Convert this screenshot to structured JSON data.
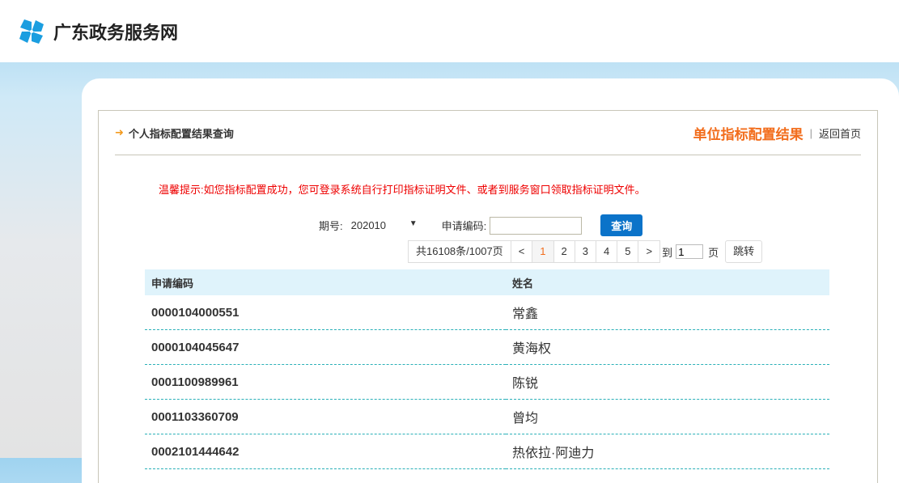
{
  "site": {
    "title": "广东政务服务网"
  },
  "panel": {
    "title": "个人指标配置结果查询",
    "link_unit": "单位指标配置结果",
    "separator": "|",
    "link_home": "返回首页",
    "tip": "温馨提示:如您指标配置成功，您可登录系统自行打印指标证明文件、或者到服务窗口领取指标证明文件。"
  },
  "query": {
    "period_label": "期号:",
    "period_value": "202010",
    "code_label": "申请编码:",
    "code_value": "",
    "search_button": "查询"
  },
  "pager": {
    "summary": "共16108条/1007页",
    "prev": "<",
    "pages": [
      "1",
      "2",
      "3",
      "4",
      "5"
    ],
    "current": "1",
    "next": ">",
    "goto_label": "到",
    "goto_value": "1",
    "page_unit": "页",
    "jump_button": "跳转"
  },
  "table": {
    "headers": [
      "申请编码",
      "姓名"
    ],
    "rows": [
      [
        "0000104000551",
        "常鑫"
      ],
      [
        "0000104045647",
        "黄海权"
      ],
      [
        "0001100989961",
        "陈锐"
      ],
      [
        "0001103360709",
        "曾均"
      ],
      [
        "0002101444642",
        "热依拉·阿迪力"
      ]
    ]
  }
}
